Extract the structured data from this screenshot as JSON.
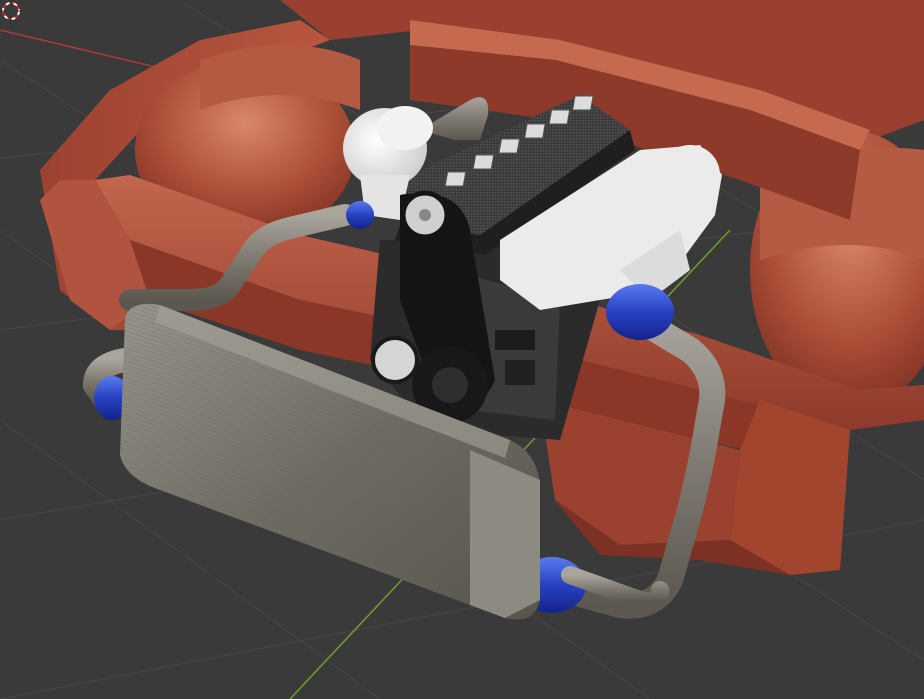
{
  "viewport": {
    "editor": "3d-viewport",
    "background_color": "#3a3a3a",
    "grid_line_color": "#4a4a4a",
    "axis_x_color": "#a83a3f",
    "axis_y_color": "#6d9a2a",
    "show_grid": true
  },
  "scene": {
    "objects": [
      {
        "name": "chassis-frame",
        "color": "#a84b37"
      },
      {
        "name": "intercooler",
        "color": "#7a776c"
      },
      {
        "name": "turbocharger",
        "color": "#e6e6e6"
      },
      {
        "name": "engine-block",
        "color": "#2a2a2a"
      },
      {
        "name": "intake-manifold",
        "color": "#ececec"
      },
      {
        "name": "valve-cover",
        "color": "#3b3b3b"
      },
      {
        "name": "timing-belt",
        "color": "#151515"
      },
      {
        "name": "intercooler-pipes",
        "color": "#8a8780"
      },
      {
        "name": "silicone-couplers",
        "color": "#2a46c8"
      }
    ],
    "cursor_3d": {
      "name": "3d-cursor",
      "colors": [
        "#ffffff",
        "#cc2222"
      ]
    }
  }
}
